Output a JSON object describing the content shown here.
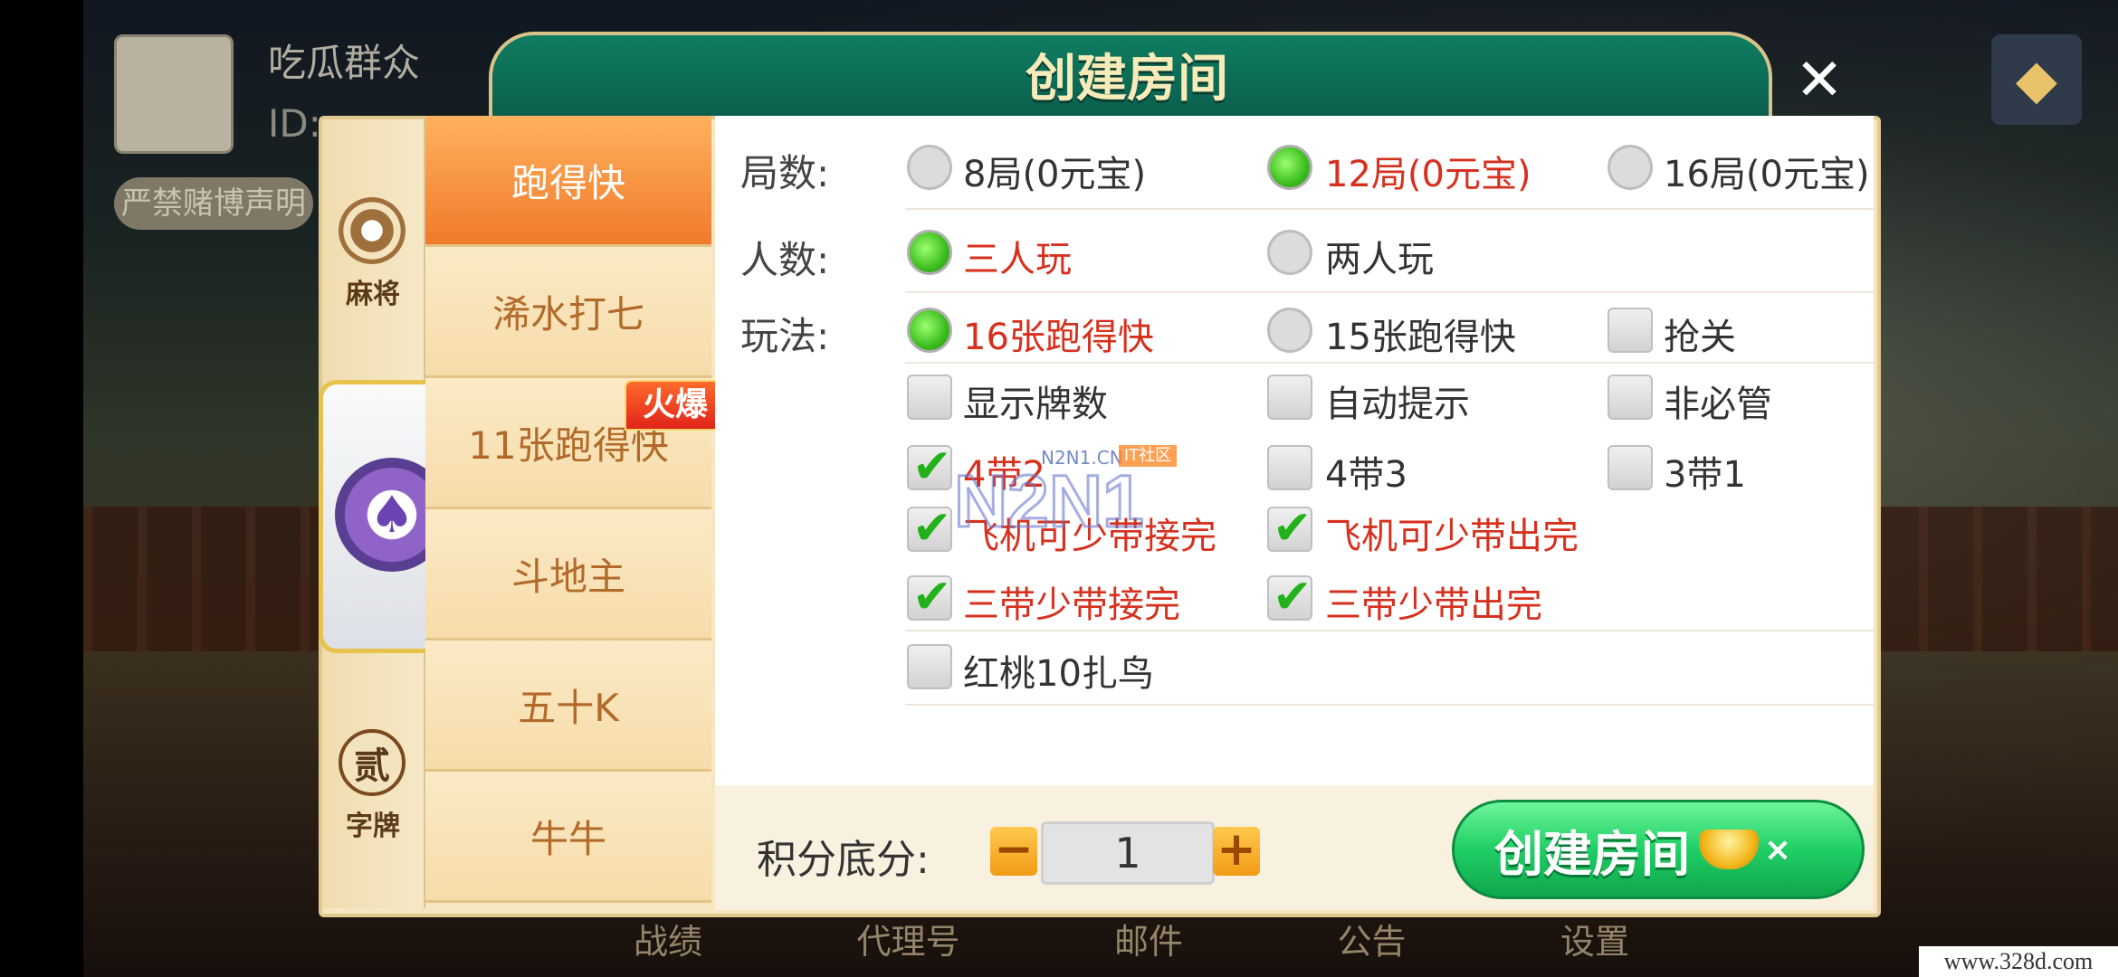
{
  "background": {
    "profile_name": "吃瓜群众",
    "profile_id": "ID:",
    "notice_label": "严禁赌博声明",
    "bottom_nav": [
      "战绩",
      "代理号",
      "邮件",
      "公告",
      "设置"
    ],
    "watermark_url": "www.328d.com"
  },
  "dialog": {
    "title": "创建房间",
    "close_icon": "close-icon"
  },
  "categories": [
    {
      "label": "麻将",
      "icon": "mahjong-icon"
    },
    {
      "label": "",
      "icon": "spade-chip-icon"
    },
    {
      "label": "字牌",
      "icon": "zipai-icon",
      "glyph": "贰"
    }
  ],
  "games": [
    {
      "label": "跑得快",
      "active": true
    },
    {
      "label": "浠水打七"
    },
    {
      "label": "11张跑得快",
      "badge": "火爆"
    },
    {
      "label": "斗地主"
    },
    {
      "label": "五十K"
    },
    {
      "label": "牛牛"
    }
  ],
  "rounds": {
    "label": "局数:",
    "options": [
      {
        "label": "8局(0元宝)",
        "selected": false
      },
      {
        "label": "12局(0元宝)",
        "selected": true
      },
      {
        "label": "16局(0元宝)",
        "selected": false
      }
    ]
  },
  "players": {
    "label": "人数:",
    "options": [
      {
        "label": "三人玩",
        "selected": true
      },
      {
        "label": "两人玩",
        "selected": false
      }
    ]
  },
  "rules": {
    "label": "玩法:",
    "modes": [
      {
        "label": "16张跑得快",
        "selected": true
      },
      {
        "label": "15张跑得快",
        "selected": false
      }
    ],
    "checks": [
      {
        "label": "抢关",
        "checked": false
      },
      {
        "label": "显示牌数",
        "checked": false
      },
      {
        "label": "自动提示",
        "checked": false
      },
      {
        "label": "非必管",
        "checked": false
      },
      {
        "label": "4带2",
        "checked": true
      },
      {
        "label": "4带3",
        "checked": false
      },
      {
        "label": "3带1",
        "checked": false
      },
      {
        "label": "飞机可少带接完",
        "checked": true
      },
      {
        "label": "飞机可少带出完",
        "checked": true
      },
      {
        "label": "三带少带接完",
        "checked": true
      },
      {
        "label": "三带少带出完",
        "checked": true
      },
      {
        "label": "红桃10扎鸟",
        "checked": false
      }
    ]
  },
  "footer": {
    "score_label": "积分底分:",
    "minus": "−",
    "score_value": "1",
    "plus": "+",
    "create_label": "创建房间",
    "cost_suffix": "×"
  },
  "watermark": {
    "logo_text": "N2N1",
    "site_text": "N2N1.CN",
    "tag": "IT社区"
  },
  "colors": {
    "accent_green": "#0f7d62",
    "selected_red": "#d6301e",
    "tab_orange": "#f07a2b",
    "create_green": "#1fcf65"
  }
}
